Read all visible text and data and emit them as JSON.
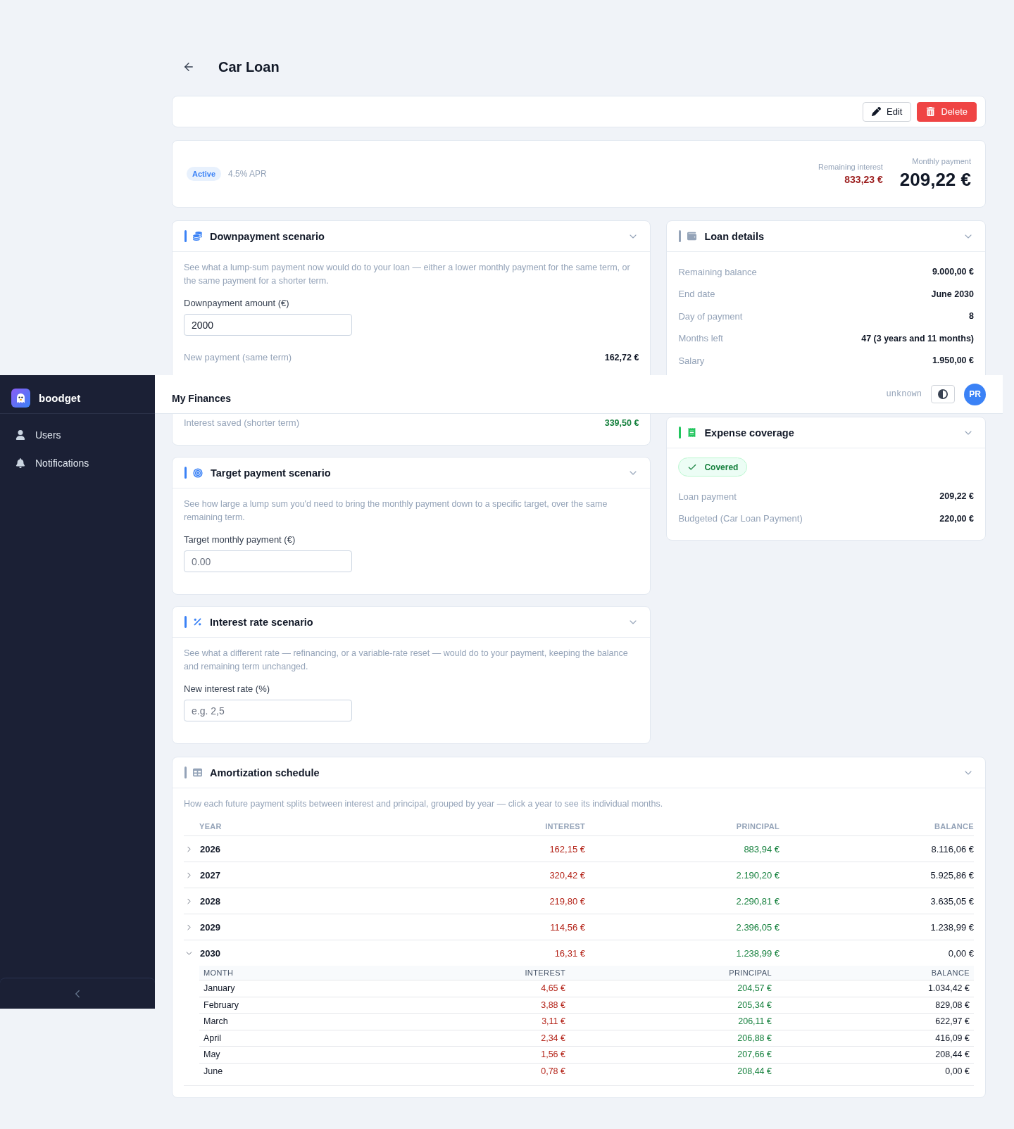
{
  "sidebar": {
    "brand": "boodget",
    "items": [
      {
        "kind": "users",
        "label": "Users",
        "selected": false
      },
      {
        "kind": "notifications",
        "label": "Notifications",
        "selected": false
      }
    ]
  },
  "top_bar": {
    "title": "My Finances",
    "user": "unknown",
    "avatar": "PR"
  },
  "page": {
    "title": "Car Loan"
  },
  "actions": [
    {
      "kind": "edit",
      "label": "Edit"
    },
    {
      "kind": "delete",
      "label": "Delete"
    }
  ],
  "summary": {
    "status": "Active",
    "rate": "4.5% APR",
    "stats": [
      {
        "kind": "interest",
        "label": "Remaining interest",
        "value": "833,23 €"
      },
      {
        "kind": "payment",
        "label": "Monthly payment",
        "value": "209,22 €"
      }
    ]
  },
  "left_column": [
    {
      "kind": "downpayment",
      "title": "Downpayment scenario",
      "color": "#3b82f6",
      "expanded": true,
      "description": "See what a lump-sum payment now would do to your loan — either a lower monthly payment for the same term, or the same payment for a shorter term.",
      "field": {
        "label": "Downpayment amount (€)",
        "value": "2000"
      },
      "results": [
        {
          "label": "New payment (same term)",
          "value": "162,72 €",
          "kind": "amount"
        },
        {
          "label": "Interest saved (shorter term)",
          "value": "339,50 €",
          "kind": "saving"
        }
      ]
    },
    {
      "kind": "target",
      "title": "Target payment scenario",
      "color": "#3b82f6",
      "expanded": true,
      "description": "See how large a lump sum you'd need to bring the monthly payment down to a specific target, over the same remaining term.",
      "field": {
        "label": "Target monthly payment (€)",
        "placeholder": "0.00"
      }
    },
    {
      "kind": "rate",
      "title": "Interest rate scenario",
      "color": "#3b82f6",
      "expanded": true,
      "description": "See what a different rate — refinancing, or a variable-rate reset — would do to your payment, keeping the balance and remaining term unchanged.",
      "field": {
        "label": "New interest rate (%)",
        "placeholder": "e.g. 2,5"
      }
    }
  ],
  "right_column": [
    {
      "kind": "details",
      "title": "Loan details",
      "color": "#94a3b8",
      "expanded": true,
      "rows": [
        {
          "label": "Remaining balance",
          "value": "9.000,00 €"
        },
        {
          "label": "End date",
          "value": "June 2030"
        },
        {
          "label": "Day of payment",
          "value": "8"
        },
        {
          "label": "Months left",
          "value": "47 (3 years and 11 months)"
        },
        {
          "label": "Salary",
          "value": "1.950,00 €"
        }
      ]
    },
    {
      "kind": "coverage",
      "title": "Expense coverage",
      "color": "#22c55e",
      "expanded": true,
      "status": "Covered",
      "rows": [
        {
          "label": "Loan payment",
          "value": "209,22 €"
        },
        {
          "label": "Budgeted (Car Loan Payment)",
          "value": "220,00 €"
        }
      ]
    }
  ],
  "schedule": {
    "kind": "schedule",
    "title": "Amortization schedule",
    "color": "#94a3b8",
    "expanded": true,
    "description": "How each future payment splits between interest and principal, grouped by year — click a year to see its individual months.",
    "columns": [
      {
        "kind": "year",
        "label": "YEAR"
      },
      {
        "kind": "interest",
        "label": "INTEREST"
      },
      {
        "kind": "principal",
        "label": "PRINCIPAL"
      },
      {
        "kind": "balance",
        "label": "BALANCE"
      }
    ],
    "rows": [
      {
        "expanded": false,
        "cells": [
          "2026",
          "162,15 €",
          "883,94 €",
          "8.116,06 €"
        ]
      },
      {
        "expanded": false,
        "cells": [
          "2027",
          "320,42 €",
          "2.190,20 €",
          "5.925,86 €"
        ]
      },
      {
        "expanded": false,
        "cells": [
          "2028",
          "219,80 €",
          "2.290,81 €",
          "3.635,05 €"
        ]
      },
      {
        "expanded": false,
        "cells": [
          "2029",
          "114,56 €",
          "2.396,05 €",
          "1.238,99 €"
        ]
      },
      {
        "expanded": true,
        "cells": [
          "2030",
          "16,31 €",
          "1.238,99 €",
          "0,00 €"
        ],
        "months": {
          "columns": [
            {
              "kind": "month",
              "label": "MONTH"
            },
            {
              "kind": "interest",
              "label": "INTEREST"
            },
            {
              "kind": "principal",
              "label": "PRINCIPAL"
            },
            {
              "kind": "balance",
              "label": "BALANCE"
            }
          ],
          "rows": [
            [
              "January",
              "4,65 €",
              "204,57 €",
              "1.034,42 €"
            ],
            [
              "February",
              "3,88 €",
              "205,34 €",
              "829,08 €"
            ],
            [
              "March",
              "3,11 €",
              "206,11 €",
              "622,97 €"
            ],
            [
              "April",
              "2,34 €",
              "206,88 €",
              "416,09 €"
            ],
            [
              "May",
              "1,56 €",
              "207,66 €",
              "208,44 €"
            ],
            [
              "June",
              "0,78 €",
              "208,44 €",
              "0,00 €"
            ]
          ]
        }
      }
    ]
  }
}
